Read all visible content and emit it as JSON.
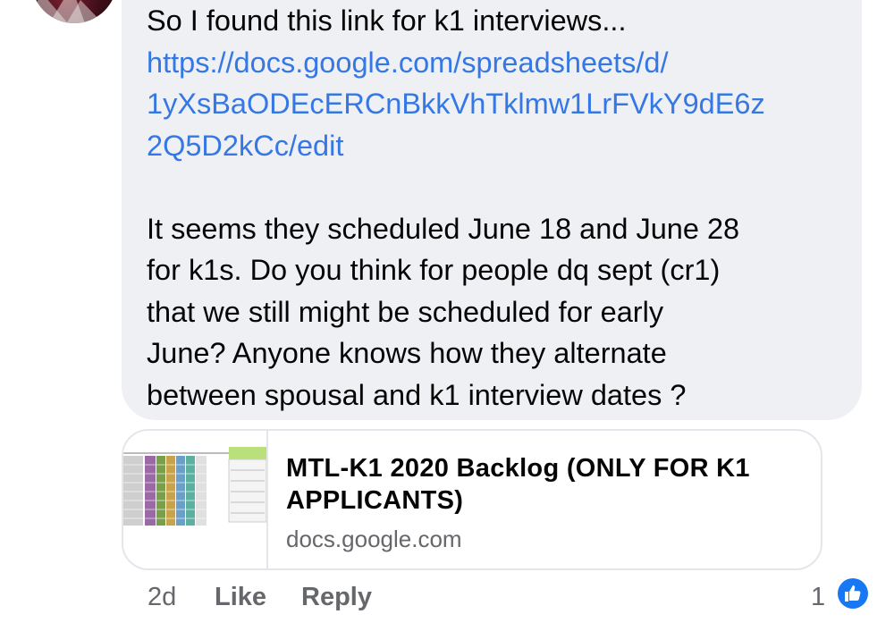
{
  "comment": {
    "text_lines": [
      "So I found this link for k1 interviews...",
      "https://docs.google.com/spreadsheets/d/",
      "1yXsBaODEcERCnBkkVhTklmw1LrFVkY9dE6z",
      "2Q5D2kCc/edit",
      "",
      "It seems they scheduled June 18 and June 28",
      "for k1s. Do you think for people dq sept (cr1)",
      "that we still might be scheduled for early",
      "June? Anyone knows how they alternate",
      "between spousal and k1 interview dates ?"
    ]
  },
  "link_preview": {
    "title": "MTL-K1 2020 Backlog (ONLY FOR K1 APPLICANTS)",
    "domain": "docs.google.com"
  },
  "actions": {
    "timestamp": "2d",
    "like_label": "Like",
    "reply_label": "Reply",
    "reaction_count": "1"
  },
  "colors": {
    "bubble": "#eef0f3",
    "link": "#3578e5",
    "like_icon": "#1877f2"
  },
  "icons": {
    "reaction": "thumbs-up-icon"
  }
}
